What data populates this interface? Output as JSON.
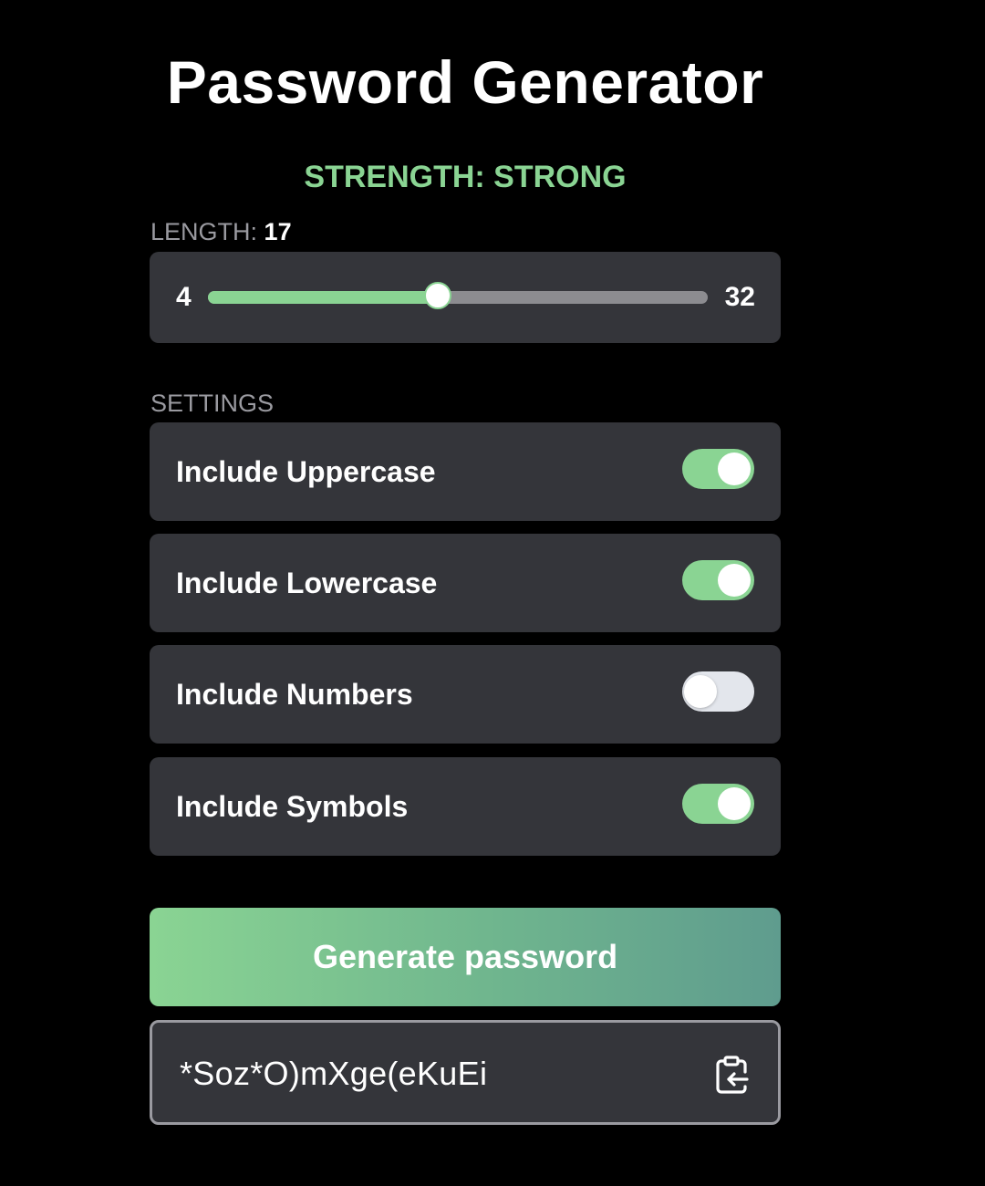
{
  "header": {
    "title": "Password Generator"
  },
  "strength": {
    "label": "STRENGTH: STRONG",
    "color": "#8ad493"
  },
  "length": {
    "label": "LENGTH:",
    "value": "17",
    "min": "4",
    "max": "32"
  },
  "settings": {
    "label": "SETTINGS",
    "items": [
      {
        "label": "Include Uppercase",
        "enabled": true
      },
      {
        "label": "Include Lowercase",
        "enabled": true
      },
      {
        "label": "Include Numbers",
        "enabled": false
      },
      {
        "label": "Include Symbols",
        "enabled": true
      }
    ]
  },
  "actions": {
    "generate_label": "Generate password"
  },
  "output": {
    "password": "*Soz*O)mXge(eKuEi",
    "copy_icon": "clipboard-copy-icon"
  },
  "colors": {
    "accent": "#8ad493",
    "panel": "#34353a",
    "background": "#000000",
    "muted_text": "#9a9aa0",
    "toggle_off": "#e3e6ec"
  }
}
